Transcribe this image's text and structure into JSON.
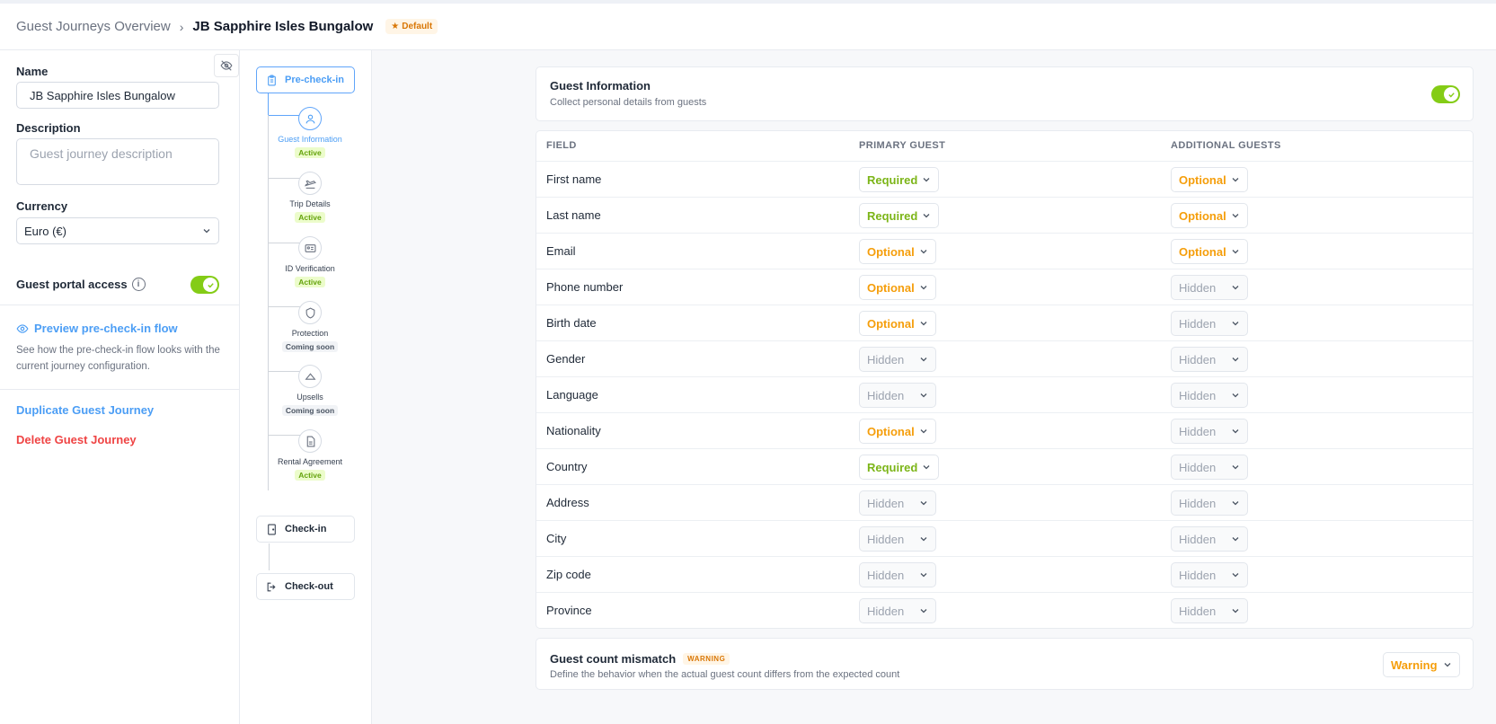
{
  "header": {
    "breadcrumb_root": "Guest Journeys Overview",
    "breadcrumb_sep": "›",
    "title": "JB Sapphire Isles Bungalow",
    "badge": "Default"
  },
  "sidebar": {
    "name_label": "Name",
    "name_value": "JB Sapphire Isles Bungalow",
    "description_label": "Description",
    "description_placeholder": "Guest journey description",
    "currency_label": "Currency",
    "currency_value": "Euro (€)",
    "portal_label": "Guest portal access",
    "portal_enabled": true,
    "preview_link": "Preview pre-check-in flow",
    "preview_help": "See how the pre-check-in flow looks with the current journey configuration.",
    "duplicate_link": "Duplicate Guest Journey",
    "delete_link": "Delete Guest Journey"
  },
  "steps": {
    "precheckin_label": "Pre-check-in",
    "items": [
      {
        "name": "Guest Information",
        "status": "Active",
        "icon": "user-icon"
      },
      {
        "name": "Trip Details",
        "status": "Active",
        "icon": "plane-icon"
      },
      {
        "name": "ID Verification",
        "status": "Active",
        "icon": "id-card-icon"
      },
      {
        "name": "Protection",
        "status": "Coming soon",
        "icon": "shield-icon"
      },
      {
        "name": "Upsells",
        "status": "Coming soon",
        "icon": "hanger-icon"
      },
      {
        "name": "Rental Agreement",
        "status": "Active",
        "icon": "document-icon"
      }
    ],
    "checkin_label": "Check-in",
    "checkout_label": "Check-out"
  },
  "guest_info": {
    "title": "Guest Information",
    "subtitle": "Collect personal details from guests",
    "enabled": true
  },
  "table": {
    "headers": [
      "FIELD",
      "PRIMARY GUEST",
      "ADDITIONAL GUESTS"
    ],
    "rows": [
      {
        "field": "First name",
        "primary": "Required",
        "additional": "Optional"
      },
      {
        "field": "Last name",
        "primary": "Required",
        "additional": "Optional"
      },
      {
        "field": "Email",
        "primary": "Optional",
        "additional": "Optional"
      },
      {
        "field": "Phone number",
        "primary": "Optional",
        "additional": "Hidden"
      },
      {
        "field": "Birth date",
        "primary": "Optional",
        "additional": "Hidden"
      },
      {
        "field": "Gender",
        "primary": "Hidden",
        "additional": "Hidden"
      },
      {
        "field": "Language",
        "primary": "Hidden",
        "additional": "Hidden"
      },
      {
        "field": "Nationality",
        "primary": "Optional",
        "additional": "Hidden"
      },
      {
        "field": "Country",
        "primary": "Required",
        "additional": "Hidden"
      },
      {
        "field": "Address",
        "primary": "Hidden",
        "additional": "Hidden"
      },
      {
        "field": "City",
        "primary": "Hidden",
        "additional": "Hidden"
      },
      {
        "field": "Zip code",
        "primary": "Hidden",
        "additional": "Hidden"
      },
      {
        "field": "Province",
        "primary": "Hidden",
        "additional": "Hidden"
      }
    ]
  },
  "mismatch": {
    "title": "Guest count mismatch",
    "chip": "WARNING",
    "subtitle": "Define the behavior when the actual guest count differs from the expected count",
    "value": "Warning"
  },
  "colors": {
    "accent": "#4c9ef5",
    "required": "#7cb518",
    "optional": "#f59e0b",
    "hidden": "#9ca3af",
    "danger": "#ef4444",
    "toggle_on": "#84cc16"
  }
}
